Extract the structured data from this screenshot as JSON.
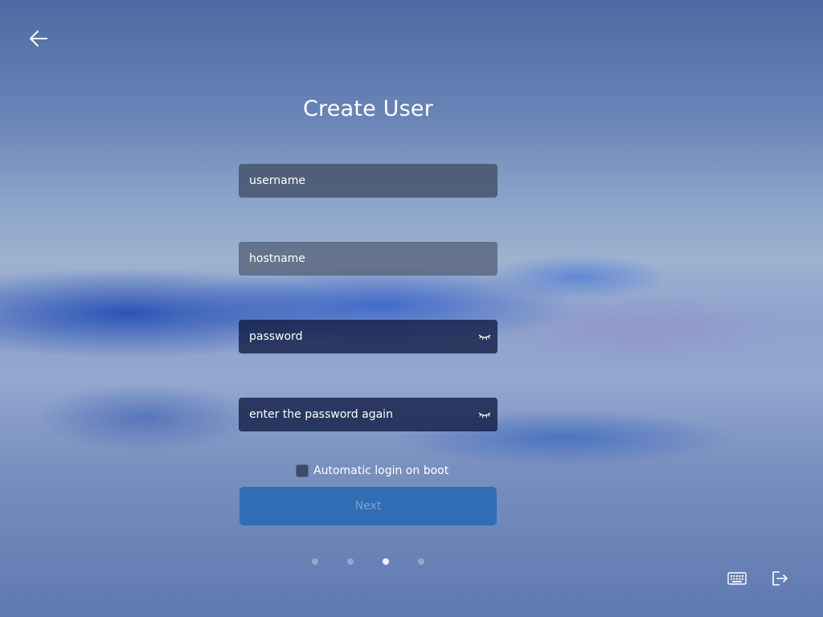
{
  "header": {
    "back_icon": "arrow-left-icon",
    "title": "Create User"
  },
  "form": {
    "username": {
      "value": "",
      "placeholder": "username"
    },
    "hostname": {
      "value": "",
      "placeholder": "hostname"
    },
    "password": {
      "value": "",
      "placeholder": "password",
      "icon": "eye-closed-icon"
    },
    "password_confirm": {
      "value": "",
      "placeholder": "enter the password again",
      "icon": "eye-closed-icon"
    },
    "auto_login": {
      "label": "Automatic login on boot",
      "checked": false
    },
    "next_label": "Next"
  },
  "pagination": {
    "total": 4,
    "current": 3
  },
  "footer": {
    "keyboard_icon": "keyboard-icon",
    "exit_icon": "exit-icon"
  },
  "colors": {
    "next_button_bg": "#2f6eb5",
    "next_button_text": "#7ea2cf",
    "checkbox_bg": "#3d4b6b"
  }
}
